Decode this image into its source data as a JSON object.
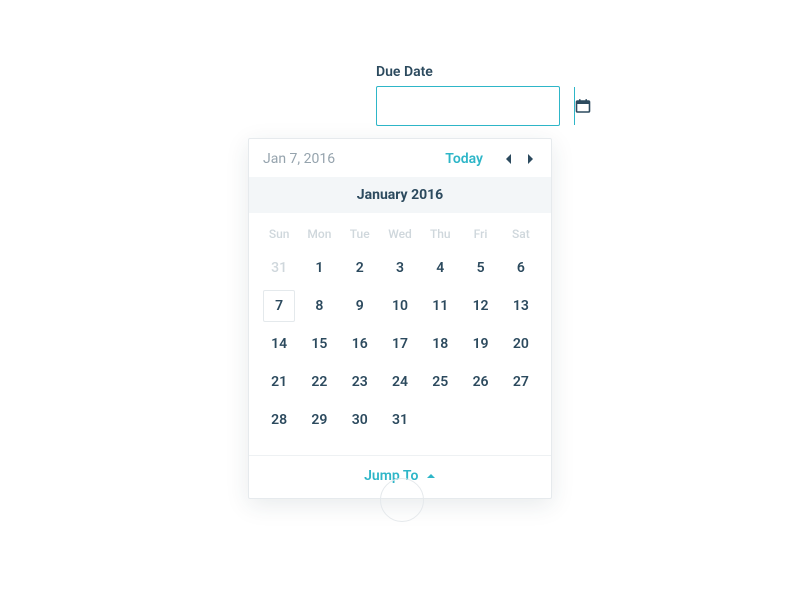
{
  "field": {
    "label": "Due Date",
    "value": "",
    "placeholder": ""
  },
  "calendar": {
    "selected_date_display": "Jan 7, 2016",
    "today_label": "Today",
    "month_title": "January 2016",
    "dow": [
      "Sun",
      "Mon",
      "Tue",
      "Wed",
      "Thu",
      "Fri",
      "Sat"
    ],
    "rows": [
      [
        {
          "n": "31",
          "other": true
        },
        {
          "n": "1"
        },
        {
          "n": "2"
        },
        {
          "n": "3"
        },
        {
          "n": "4"
        },
        {
          "n": "5"
        },
        {
          "n": "6"
        }
      ],
      [
        {
          "n": "7",
          "selected": true
        },
        {
          "n": "8"
        },
        {
          "n": "9"
        },
        {
          "n": "10"
        },
        {
          "n": "11"
        },
        {
          "n": "12"
        },
        {
          "n": "13"
        }
      ],
      [
        {
          "n": "14"
        },
        {
          "n": "15"
        },
        {
          "n": "16"
        },
        {
          "n": "17"
        },
        {
          "n": "18"
        },
        {
          "n": "19"
        },
        {
          "n": "20"
        }
      ],
      [
        {
          "n": "21"
        },
        {
          "n": "22"
        },
        {
          "n": "23"
        },
        {
          "n": "24"
        },
        {
          "n": "25"
        },
        {
          "n": "26"
        },
        {
          "n": "27"
        }
      ],
      [
        {
          "n": "28"
        },
        {
          "n": "29"
        },
        {
          "n": "30"
        },
        {
          "n": "31"
        },
        {
          "n": ""
        },
        {
          "n": ""
        },
        {
          "n": ""
        }
      ]
    ],
    "jump_to_label": "Jump To"
  },
  "icons": {
    "calendar": "calendar-icon",
    "chevron_left": "chevron-left-icon",
    "chevron_right": "chevron-right-icon",
    "caret_up": "caret-up-icon"
  },
  "colors": {
    "accent": "#2eb6c8",
    "text": "#2c4a5e",
    "muted": "#95a3ad",
    "faint": "#cfd7dc",
    "panel_border": "#e6eaed",
    "month_bg": "#f3f6f8"
  }
}
